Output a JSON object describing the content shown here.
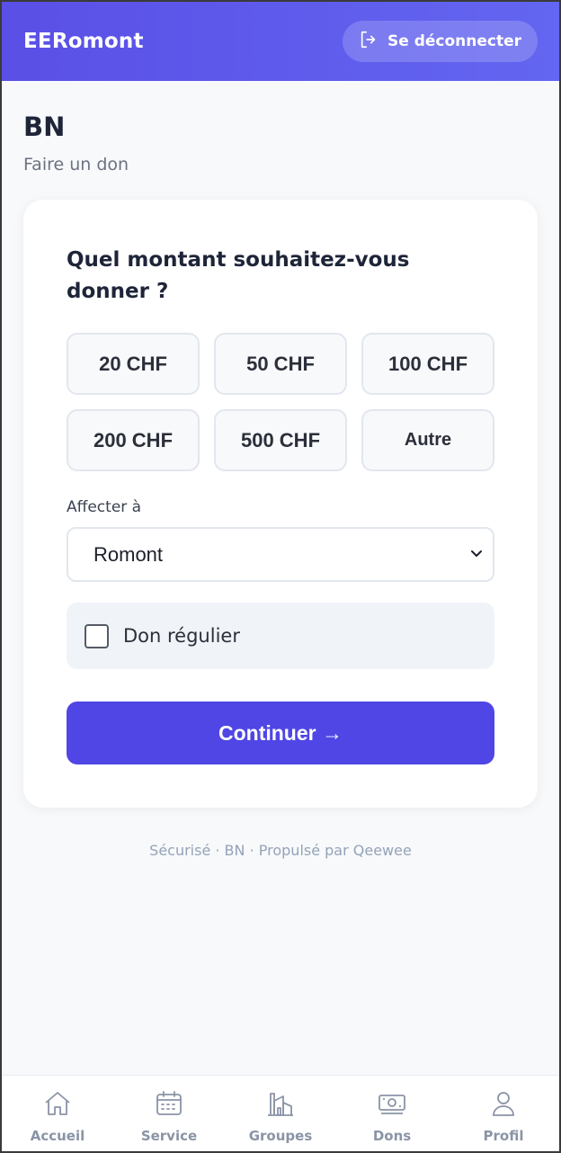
{
  "header": {
    "brand": "EERomont",
    "logout_label": "Se déconnecter",
    "logout_icon": "logout-icon"
  },
  "page": {
    "title": "BN",
    "subtitle": "Faire un don"
  },
  "donation": {
    "question": "Quel montant souhaitez-vous donner ?",
    "amounts": [
      "20 CHF",
      "50 CHF",
      "100 CHF",
      "200 CHF",
      "500 CHF",
      "Autre"
    ],
    "assign_label": "Affecter à",
    "assign_value": "Romont",
    "recurring_label": "Don régulier",
    "recurring_checked": false,
    "continue_label": "Continuer →"
  },
  "footer": {
    "note": "Sécurisé · BN · Propulsé par Qeewee"
  },
  "tabs": [
    {
      "label": "Accueil",
      "icon": "home-icon"
    },
    {
      "label": "Service",
      "icon": "calendar-icon"
    },
    {
      "label": "Groupes",
      "icon": "building-icon"
    },
    {
      "label": "Dons",
      "icon": "money-icon"
    },
    {
      "label": "Profil",
      "icon": "user-icon"
    }
  ],
  "colors": {
    "header_gradient_start": "#5a4fe6",
    "header_gradient_end": "#6366f1",
    "primary_button": "#4f46e5",
    "tab_inactive": "#8a94a6"
  }
}
